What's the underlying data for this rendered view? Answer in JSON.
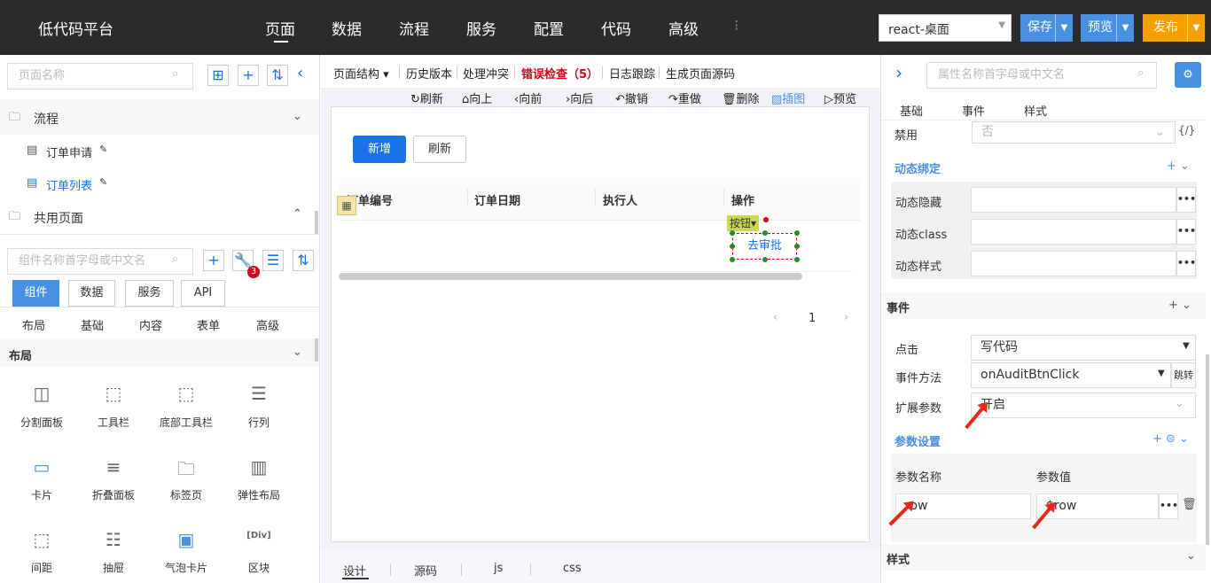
{
  "app": {
    "title": "低代码平台"
  },
  "nav": {
    "items": [
      "页面",
      "数据",
      "流程",
      "服务",
      "配置",
      "代码",
      "高级",
      "⁝"
    ],
    "active": "页面"
  },
  "header": {
    "env_select": "react-桌面",
    "save": "保存",
    "preview": "预览",
    "publish": "发布",
    "colors": {
      "save": "#4a90e2",
      "preview": "#4a90e2",
      "publish": "#f5a000",
      "bar": "#2b2b2b"
    }
  },
  "left": {
    "page_search_placeholder": "页面名称",
    "group_flow": "流程",
    "tree": [
      "订单申请",
      "订单列表"
    ],
    "group_shared": "共用页面",
    "comp_search_placeholder": "组件名称首字母或中文名",
    "badge": "3",
    "tabs": [
      "组件",
      "数据",
      "服务",
      "API"
    ],
    "subtabs": [
      "布局",
      "基础",
      "内容",
      "表单",
      "高级"
    ],
    "section": "布局",
    "components": [
      "分割面板",
      "工具栏",
      "底部工具栏",
      "行列",
      "卡片",
      "折叠面板",
      "标签页",
      "弹性布局",
      "间距",
      "抽屉",
      "气泡卡片",
      "区块"
    ]
  },
  "center": {
    "toolbar": [
      "页面结构",
      "历史版本",
      "处理冲突",
      "错误检查（5）",
      "日志跟踪",
      "生成页面源码"
    ],
    "actions": [
      "刷新",
      "向上",
      "向前",
      "向后",
      "撤销",
      "重做",
      "删除",
      "插图",
      "预览"
    ],
    "add_button": "新增",
    "refresh_button": "刷新",
    "columns": [
      "订单编号",
      "订单日期",
      "执行人",
      "操作"
    ],
    "tag": "按钮",
    "audit_button": "去审批",
    "page": "1",
    "bottom_tabs": [
      "设计",
      "源码",
      "js",
      "css"
    ]
  },
  "right": {
    "search_placeholder": "属性名称首字母或中文名",
    "tabs": [
      "基础",
      "事件",
      "样式"
    ],
    "disabled_label": "禁用",
    "disabled_value": "否",
    "dynamic_title": "动态绑定",
    "dynamic_rows": [
      "动态隐藏",
      "动态class",
      "动态样式"
    ],
    "events_title": "事件",
    "click_label": "点击",
    "click_value": "写代码",
    "method_label": "事件方法",
    "method_value": "onAuditBtnClick",
    "jump": "跳转",
    "ext_label": "扩展参数",
    "ext_value": "开启",
    "params_title": "参数设置",
    "param_name_header": "参数名称",
    "param_value_header": "参数值",
    "param_name": "row",
    "param_value": "$row",
    "style_title": "样式"
  }
}
